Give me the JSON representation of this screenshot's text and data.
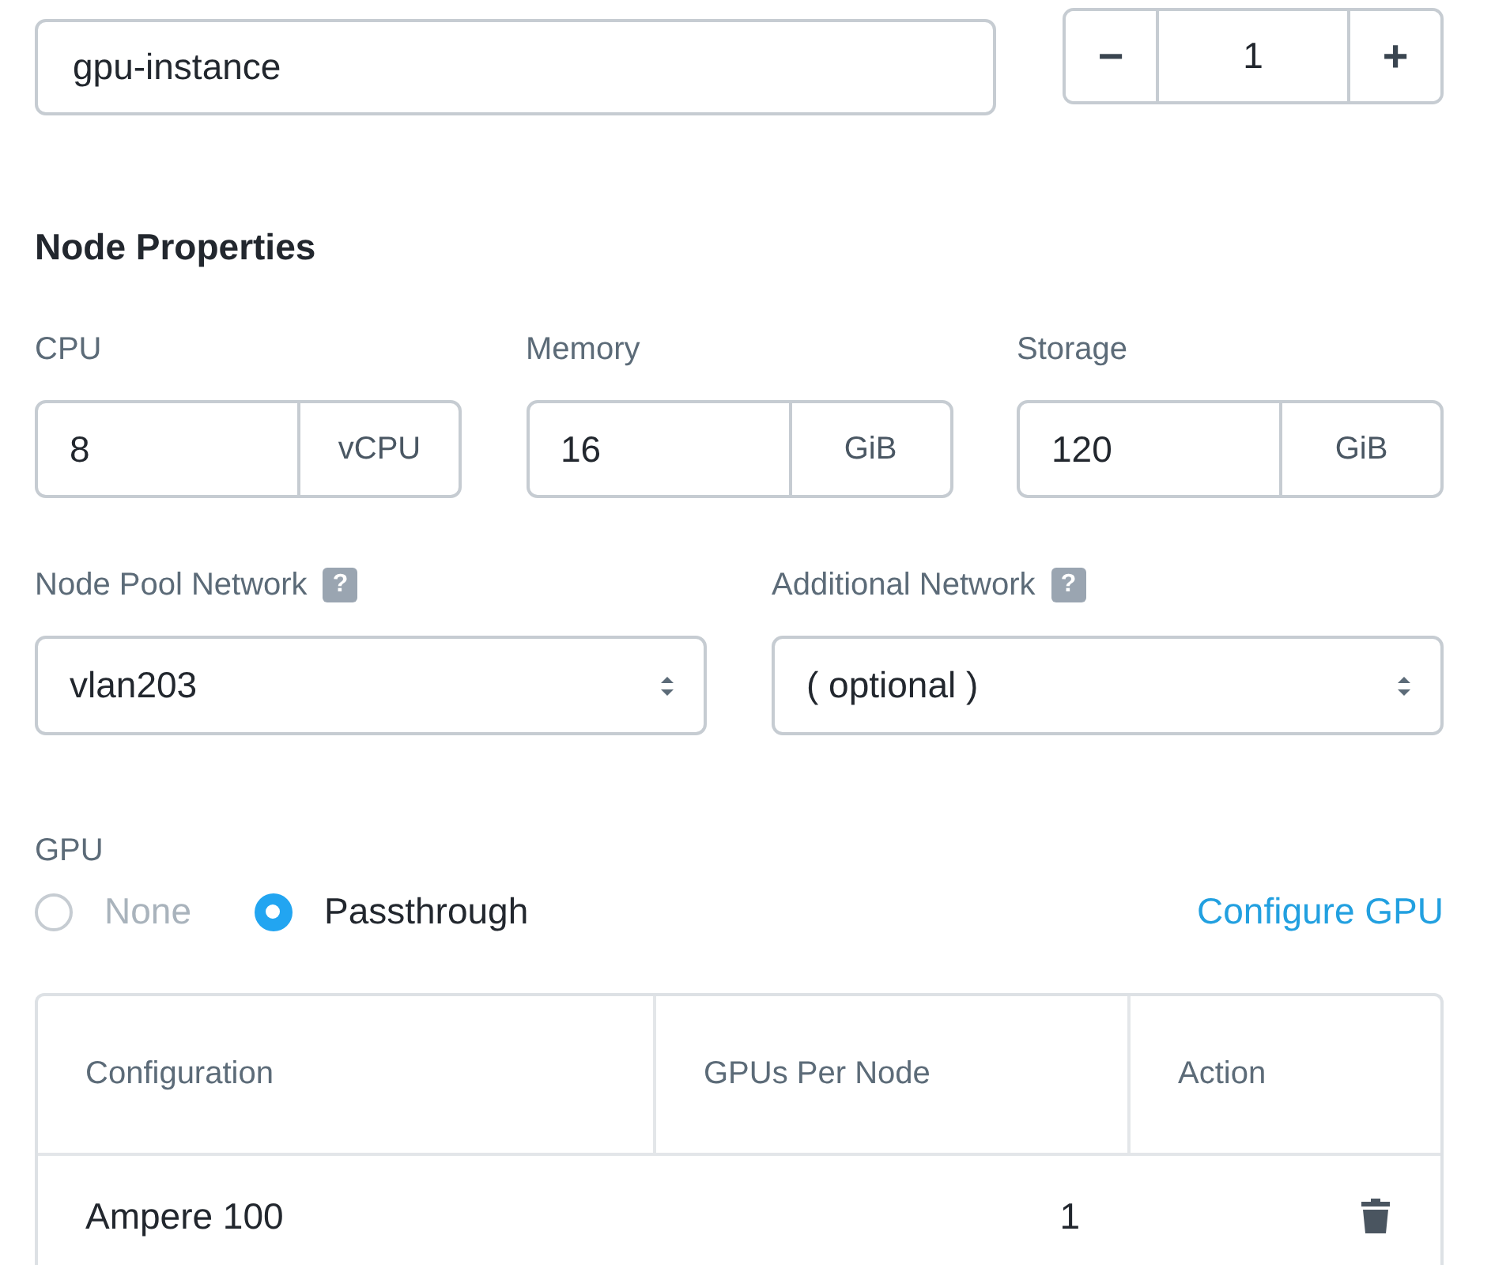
{
  "name_field": {
    "value": "gpu-instance"
  },
  "node_count": {
    "decrement": "−",
    "value": "1",
    "increment": "+"
  },
  "section_title": "Node Properties",
  "resources": [
    {
      "label": "CPU",
      "value": "8",
      "unit": "vCPU"
    },
    {
      "label": "Memory",
      "value": "16",
      "unit": "GiB"
    },
    {
      "label": "Storage",
      "value": "120",
      "unit": "GiB"
    }
  ],
  "networks": [
    {
      "label": "Node Pool Network",
      "help": "?",
      "value": "vlan203"
    },
    {
      "label": "Additional Network",
      "help": "?",
      "value": "( optional )"
    }
  ],
  "gpu": {
    "label": "GPU",
    "options": [
      {
        "label": "None",
        "selected": false
      },
      {
        "label": "Passthrough",
        "selected": true
      }
    ],
    "link": "Configure GPU"
  },
  "table": {
    "columns": [
      "Configuration",
      "GPUs Per Node",
      "Action"
    ],
    "rows": [
      {
        "configuration": "Ampere 100",
        "gpus_per_node": "1"
      }
    ]
  }
}
